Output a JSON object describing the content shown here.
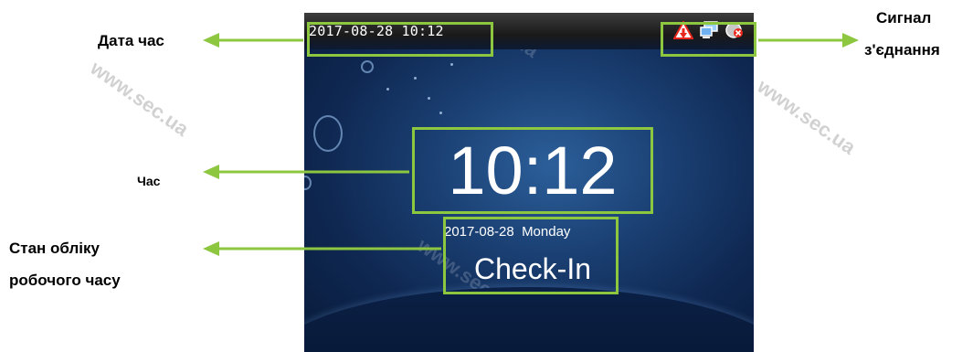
{
  "device": {
    "status_bar": {
      "datetime": "2017-08-28 10:12",
      "icons": [
        "warning-icon",
        "network-icon",
        "connection-error-icon"
      ]
    },
    "clock": "10:12",
    "date_line": "2017-08-28  Monday",
    "attendance_state": "Check-In"
  },
  "callouts": {
    "date_time": "Дата час",
    "connection_signal_line1": "Сигнал",
    "connection_signal_line2": "з'єднання",
    "time": "Час",
    "attendance_state_line1": "Стан обліку",
    "attendance_state_line2": "робочого часу"
  },
  "watermark": "www.sec.ua",
  "colors": {
    "highlight": "#8dc63f",
    "arrow": "#8dc63f",
    "screen_bg": "#1a3f72",
    "warning_red": "#e8271d"
  }
}
